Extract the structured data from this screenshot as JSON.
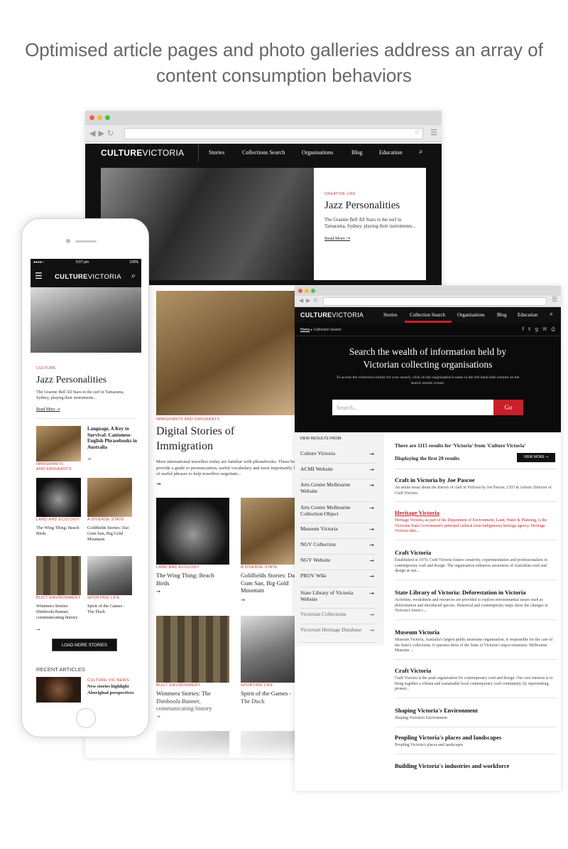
{
  "headline": "Optimised article pages and photo galleries address an array of content consumption behaviors",
  "brand": {
    "culture": "CULTURE",
    "victoria": "VICTORIA"
  },
  "desktop": {
    "nav": [
      "Stories",
      "Collections Search",
      "Organisations",
      "Blog",
      "Education"
    ],
    "hero": {
      "category": "CREATIVE LIFE",
      "title": "Jazz Personalities",
      "desc": "The Graeme Bell All Stars in the surf in Tamarama, Sydney, playing their instruments...",
      "read_more": "Read More"
    },
    "feature": {
      "category": "IMMIGRANTS AND EMIGRANTS",
      "title": "Digital Stories of Immigration",
      "desc": "Most international travellers today are familiar with phrasebooks. These books provide a guide to pronunciation, useful vocabulary and most importantly lists of useful phrases to help travellers negotiate..."
    },
    "cards": [
      {
        "category": "LAND AND ECOLOGY",
        "title": "The Wing Thing: Beach Birds"
      },
      {
        "category": "A DIVERSE STATE",
        "title": "Goldfields Stories: Dai Gum San, Big Gold Mountain"
      },
      {
        "category": "BUILT ENVIRONMENT",
        "title": "Wimmera Stories: The Dimboola Banner, communicating history"
      },
      {
        "category": "SPORTING LIFE",
        "title": "Spirit of the Games - The Duck"
      }
    ]
  },
  "mobile": {
    "status": {
      "time": "5:07 pm",
      "battery": "100%"
    },
    "hero": {
      "category": "CULTURE",
      "title": "Jazz Personalities",
      "desc": "The Graeme Bell All Stars in the surf in Tamarama, Sydney, playing their instruments...",
      "read_more": "Read More"
    },
    "list": [
      {
        "category": "IMMIGRANTS AND EMIGRANTS",
        "title": "Language, A Key to Survival: Cantonese-English Phrasebooks in Australia"
      }
    ],
    "cards": [
      {
        "category": "LAND AND ECOLOGY",
        "title": "The Wing Thing: Beach Birds"
      },
      {
        "category": "A DIVERSE STATE",
        "title": "Goldfields Stories: Dai Gum San, Big Gold Mountain"
      },
      {
        "category": "BUILT ENVIRONMENT",
        "title": "Wimmera Stories: Dimboola Banner, communicating history"
      },
      {
        "category": "SPORTING LIFE",
        "title": "Spirit of the Games - The Duck"
      }
    ],
    "load_more": "LOAD MORE STORIES",
    "recent_heading": "RECENT ARTICLES",
    "recent": {
      "category": "CULTURE VIC NEWS",
      "title": "New stories highlight Aboriginal perspectives"
    }
  },
  "search": {
    "nav": [
      "Stories",
      "Collection Search",
      "Organisations",
      "Blog",
      "Education"
    ],
    "breadcrumb": {
      "home": "Home",
      "current": "Collection Search"
    },
    "title": "Search the wealth of information held by Victorian collecting organisations",
    "subtitle": "To access the collection results for your search, click on the organisation's name in the left hand side column on the search results screen.",
    "placeholder": "Search...",
    "go": "Go",
    "view_results_from": "VIEW RESULTS FROM:",
    "orgs": [
      "Culture Victoria",
      "ACMI Website",
      "Arts Centre Melbourne Website",
      "Arts Centre Melbourne Collection Object",
      "Museum Victoria",
      "NGV Collection",
      "NGV Website",
      "PROV Wiki",
      "State Library of Victoria Website",
      "Victorian Collections",
      "Victorian Heritage Database"
    ],
    "summary": "There are 1115 results for 'Victoria' from 'Culture Victoria'",
    "showing": "Displaying the first 20 results",
    "view_more": "VIEW MORE",
    "results": [
      {
        "title": "Craft in Victoria by Joe Pascoe",
        "desc": "An astute essay about the history of craft in Victoria by Joe Pascoe, CEO & Artistic Director of Craft Victoria"
      },
      {
        "title": "Heritage Victoria",
        "desc": "Heritage Victoria, as part of the Department of Environment, Land, Water & Planning, is the Victorian State Government's principal cultural (non-Indigenous) heritage agency. Heritage Victoria iden..."
      },
      {
        "title": "Craft Victoria",
        "desc": "Established in 1970, Craft Victoria fosters creativity, experimentation and professionalism in contemporary craft and design. The organisation enhances awareness of Australian craft and design at stat..."
      },
      {
        "title": "State Library of Victoria: Deforestation in Victoria",
        "desc": "Activities, worksheets and resources are provided to explore environmental issues such as deforestation and introduced species. Historical and contemporary maps show the changes in Victoria's forest c..."
      },
      {
        "title": "Museum Victoria",
        "desc": "Museum Victoria, Australia's largest public museums organisation, is responsible for the care of the State's collections. It operates three of the State of Victoria's major museums: Melbourne Museum ..."
      },
      {
        "title": "Craft Victoria",
        "desc": "Craft Victoria is the peak organisation for contemporary craft and design. Our core mission is to bring together a vibrant and sustainable local contemporary craft community, by representing, promot..."
      },
      {
        "title": "Shaping Victoria's Environment",
        "desc": "Shaping Victoria's Environment"
      },
      {
        "title": "Peopling Victoria's places and landscapes",
        "desc": "Peopling Victoria's places and landscapes"
      },
      {
        "title": "Building Victoria's industries and workforce",
        "desc": ""
      }
    ]
  },
  "colors": {
    "accent_red": "#c8202a",
    "nav_black": "#111111"
  }
}
